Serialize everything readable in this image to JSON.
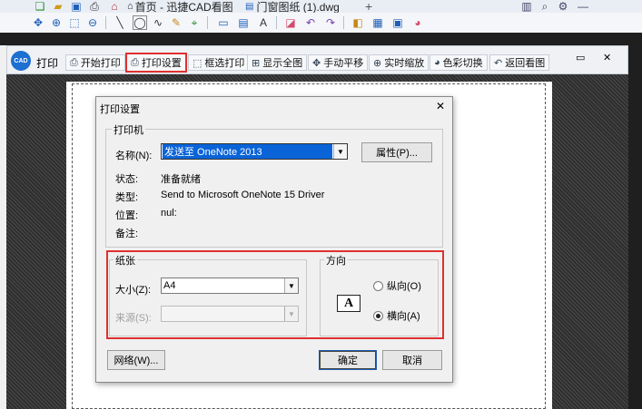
{
  "app": {
    "tabs": [
      {
        "label": "首页 - 迅捷CAD看图"
      },
      {
        "label": "门窗图纸 (1).dwg"
      }
    ],
    "new_tab": "+"
  },
  "print_toolbar": {
    "logo_text": "CAD",
    "title": "打印",
    "buttons": [
      "开始打印",
      "打印设置",
      "框选打印",
      "显示全图",
      "手动平移",
      "实时缩放",
      "色彩切换",
      "返回看图"
    ],
    "window_controls": [
      "▭",
      "✕"
    ]
  },
  "dialog": {
    "title": "打印设置",
    "close": "✕",
    "printer": {
      "legend": "打印机",
      "name_label": "名称(N):",
      "name_value": "发送至 OneNote 2013",
      "properties_button": "属性(P)...",
      "status_label": "状态:",
      "status_value": "准备就绪",
      "type_label": "类型:",
      "type_value": "Send to Microsoft OneNote 15 Driver",
      "where_label": "位置:",
      "where_value": "nul:",
      "comment_label": "备注:"
    },
    "paper": {
      "legend": "纸张",
      "size_label": "大小(Z):",
      "size_value": "A4",
      "source_label": "来源(S):",
      "source_value": ""
    },
    "orientation": {
      "legend": "方向",
      "portrait_label": "纵向(O)",
      "landscape_label": "横向(A)",
      "selected": "landscape",
      "preview_glyph": "A"
    },
    "network_button": "网络(W)...",
    "ok_button": "确定",
    "cancel_button": "取消"
  },
  "colors": {
    "highlight_red": "#e03030",
    "selection_blue": "#0a64d8"
  }
}
